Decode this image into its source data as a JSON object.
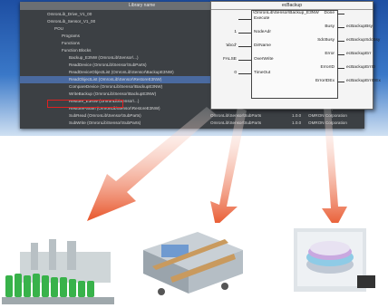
{
  "library": {
    "header": "Library name",
    "rows": [
      {
        "indent": 0,
        "label": "OmronLib_Drive_V1_00",
        "sel": false
      },
      {
        "indent": 0,
        "label": "OmronLib_Sensor_V1_00",
        "sel": false
      },
      {
        "indent": 1,
        "label": "POU",
        "sel": false
      },
      {
        "indent": 2,
        "label": "Programs",
        "sel": false
      },
      {
        "indent": 2,
        "label": "Functions",
        "sel": false
      },
      {
        "indent": 2,
        "label": "Function Blocks",
        "sel": false
      },
      {
        "indent": 3,
        "label": "Backup_E3NW (OmronLib\\Sensor\\...)",
        "sel": false
      },
      {
        "indent": 3,
        "label": "ReadDevice (OmronLib\\Sensor\\SubParts)",
        "sel": false
      },
      {
        "indent": 3,
        "label": "ReadDeviceObjectList (OmronLib\\Sensor\\BackupE3NW)",
        "sel": false
      },
      {
        "indent": 3,
        "label": "ReadObjectList (OmronLib\\Sensor\\RestoreE3NW)",
        "sel": true
      },
      {
        "indent": 3,
        "label": "CompareDevice (OmronLib\\Sensor\\BackupE3NW)",
        "sel": false
      },
      {
        "indent": 3,
        "label": "WriteBackup (OmronLib\\Sensor\\BackupE3NW)",
        "sel": false
      },
      {
        "indent": 3,
        "label": "Restore_E3NW (OmronLib\\Sensor\\...)",
        "sel": false
      },
      {
        "indent": 3,
        "label": "RestoreParam (OmronLib\\Sensor\\RestoreE3NW)",
        "sel": false
      },
      {
        "indent": 3,
        "label": "SubRead (OmronLib\\Sensor\\SubParts)",
        "sel": false
      },
      {
        "indent": 3,
        "label": "SubWrite (OmronLib\\Sensor\\SubParts)",
        "sel": false
      }
    ],
    "cols": [
      {
        "cat": "OmronLib\\Sensor\\BackupE3NW",
        "ver": "1.0.0",
        "vendor": "OMRON Corporation"
      },
      {
        "cat": "OmronLib\\Sensor\\BackupE3NW",
        "ver": "1.0.0",
        "vendor": "OMRON Corporation"
      },
      {
        "cat": "OmronLib\\Sensor\\RestoreE3NW",
        "ver": "1.0.0",
        "vendor": "OMRON Corporation"
      },
      {
        "cat": "OmronLib\\Sensor\\SubParts",
        "ver": "1.0.0",
        "vendor": "OMRON Corporation"
      },
      {
        "cat": "OmronLib\\Sensor\\SubParts",
        "ver": "1.0.0",
        "vendor": "OMRON Corporation"
      }
    ]
  },
  "fb": {
    "instance": "ecBackup",
    "type": "\\OmronLib\\Sensor\\Backup_E3NW",
    "inputs": [
      {
        "arg": "",
        "name": "Execute"
      },
      {
        "arg": "1",
        "name": "NodeAdr"
      },
      {
        "arg": "'abcd'",
        "name": "DirName"
      },
      {
        "arg": "FALSE",
        "name": "OverWrite"
      },
      {
        "arg": "0",
        "name": "TimeOut"
      }
    ],
    "outputs": [
      {
        "name": "Done",
        "arg": ""
      },
      {
        "name": "Busy",
        "arg": "ecBackupBsy"
      },
      {
        "name": "SdcBusy",
        "arg": "ecBackupSdcBsy"
      },
      {
        "name": "Error",
        "arg": "ecBackupErr"
      },
      {
        "name": "ErrorID",
        "arg": "ecBackupErrID"
      },
      {
        "name": "ErrorIDEx",
        "arg": "ecBackupErrIDEx"
      }
    ]
  },
  "colors": {
    "arrow": "#e8552a",
    "highlight": "#e02020",
    "band": "#2a62b6"
  }
}
